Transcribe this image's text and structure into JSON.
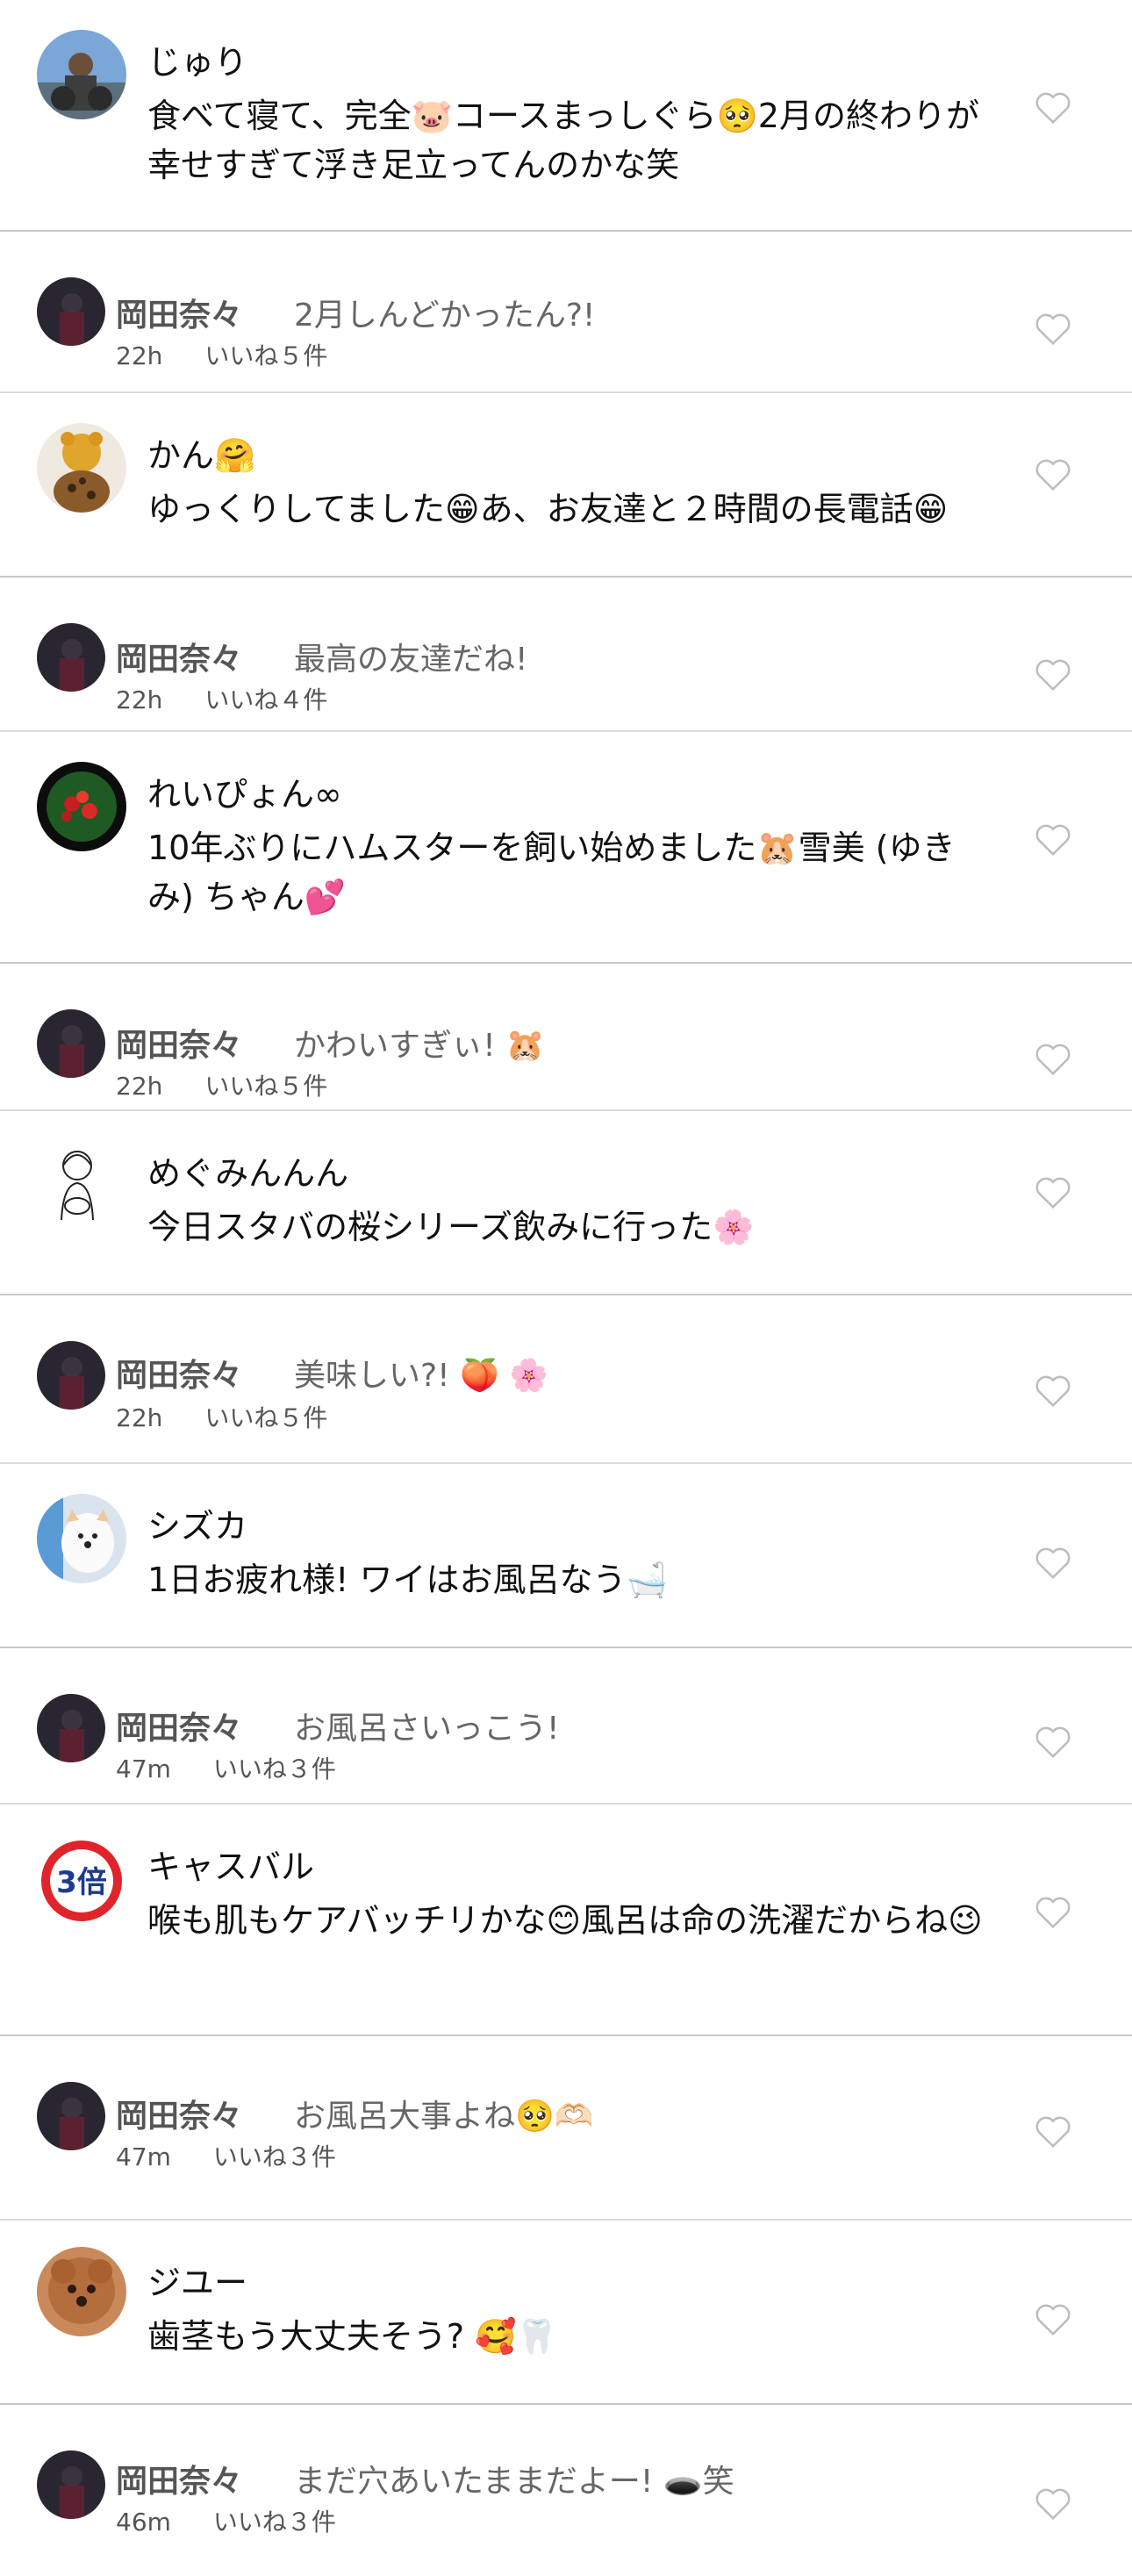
{
  "comments": [
    {
      "name": "じゅり",
      "text": "食べて寝て、完全🐷コースまっしぐら🥺2月の終わりが幸せすぎて浮き足立ってんのかな笑",
      "reply": {
        "name": "岡田奈々",
        "text": "2月しんどかったん?!",
        "time": "22h",
        "likes": "いいね５件"
      }
    },
    {
      "name": "かん🤗",
      "text": "ゆっくりしてました😁あ、お友達と２時間の長電話😁",
      "reply": {
        "name": "岡田奈々",
        "text": "最高の友達だね!",
        "time": "22h",
        "likes": "いいね４件"
      }
    },
    {
      "name": "れいぴょん∞",
      "text": "10年ぶりにハムスターを飼い始めました🐹雪美 (ゆきみ) ちゃん💕",
      "reply": {
        "name": "岡田奈々",
        "text": "かわいすぎぃ! 🐹",
        "time": "22h",
        "likes": "いいね５件"
      }
    },
    {
      "name": "めぐみんんん",
      "text": "今日スタバの桜シリーズ飲みに行った🌸",
      "reply": {
        "name": "岡田奈々",
        "text": "美味しい?! 🍑 🌸",
        "time": "22h",
        "likes": "いいね５件"
      }
    },
    {
      "name": "シズカ",
      "text": "1日お疲れ様! ワイはお風呂なう🛁",
      "reply": {
        "name": "岡田奈々",
        "text": "お風呂さいっこう!",
        "time": "47m",
        "likes": "いいね３件"
      }
    },
    {
      "name": "キャスバル",
      "text": "喉も肌もケアバッチリかな😊風呂は命の洗濯だからね😉",
      "reply": {
        "name": "岡田奈々",
        "text": "お風呂大事よね🥺🫶🏻",
        "time": "47m",
        "likes": "いいね３件"
      }
    },
    {
      "name": "ジユー",
      "text": "歯茎もう大丈夫そう? 🥰🦷",
      "reply": {
        "name": "岡田奈々",
        "text": "まだ穴あいたままだよー! 🕳️笑",
        "time": "46m",
        "likes": "いいね３件"
      }
    }
  ],
  "avatars": {
    "c3_badge": "3倍"
  },
  "colors": {
    "separator": "#c9c9c9",
    "heart": "#bdbdbd"
  }
}
